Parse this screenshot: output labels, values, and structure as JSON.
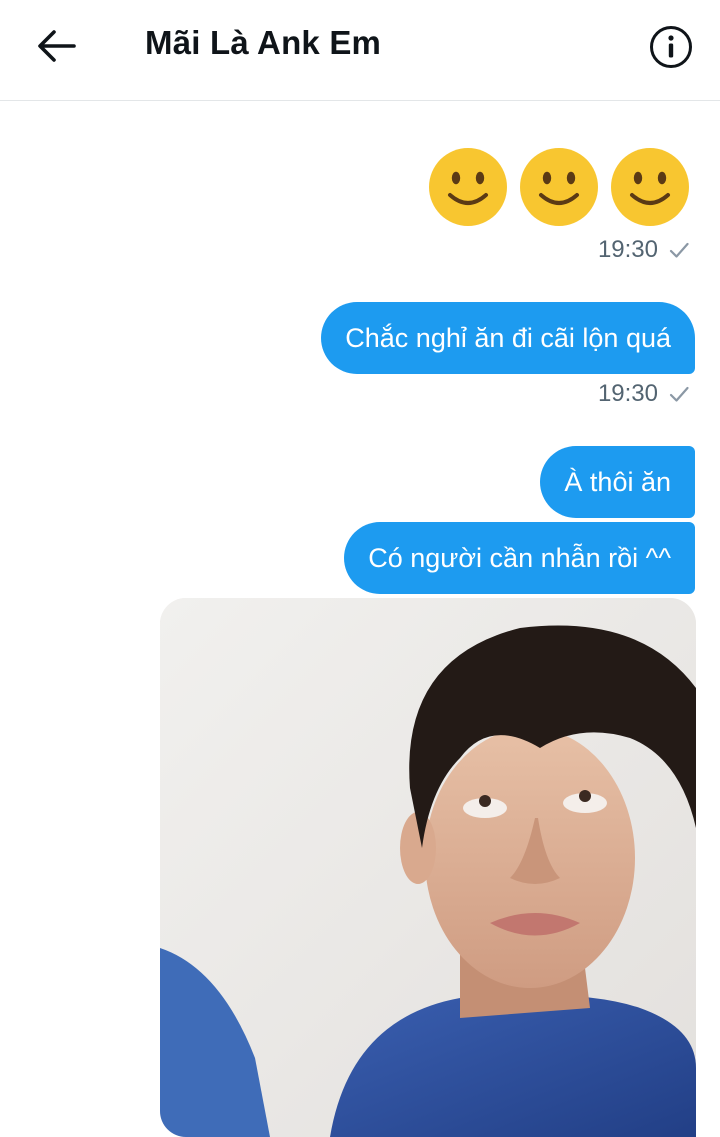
{
  "header": {
    "title": "Mãi Là Ank Em",
    "back_icon": "arrow-left-icon",
    "info_icon": "info-circle-icon"
  },
  "messages": [
    {
      "type": "emoji",
      "content": [
        "🙂",
        "🙂",
        "🙂"
      ],
      "time": "19:30",
      "status_icon": "check-icon"
    },
    {
      "type": "text",
      "text": "Chắc nghỉ ăn đi cãi lộn quá",
      "time": "19:30",
      "status_icon": "check-icon"
    },
    {
      "type": "text",
      "text": "À thôi ăn"
    },
    {
      "type": "text",
      "text": "Có người cần nhẫn rồi ^^"
    },
    {
      "type": "image",
      "description_icon": "photo-attachment"
    }
  ],
  "colors": {
    "bubble": "#1d9bf0",
    "timestamp": "#536471",
    "check": "#8b98a5",
    "emoji_face": "#f8c630"
  }
}
